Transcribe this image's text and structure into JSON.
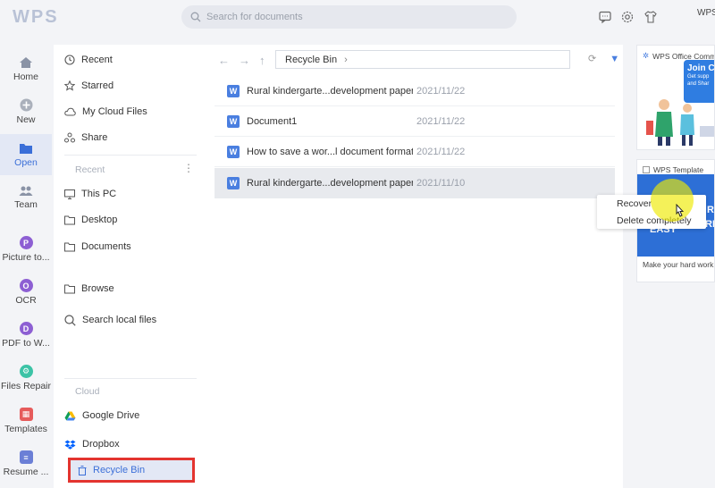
{
  "header": {
    "logo": "WPS",
    "search_placeholder": "Search for documents",
    "user_label": "WPS"
  },
  "rail": [
    {
      "label": "Home",
      "icon": "home-icon"
    },
    {
      "label": "New",
      "icon": "plus-circle-icon"
    },
    {
      "label": "Open",
      "icon": "folder-icon",
      "active": true
    },
    {
      "label": "Team",
      "icon": "team-icon"
    },
    {
      "label": "Picture to...",
      "icon": "picture-to-text-icon",
      "color": "#8d5fd3"
    },
    {
      "label": "OCR",
      "icon": "ocr-icon",
      "color": "#8d5fd3"
    },
    {
      "label": "PDF to W...",
      "icon": "pdf-to-word-icon",
      "color": "#8d5fd3"
    },
    {
      "label": "Files Repair",
      "icon": "files-repair-icon",
      "color": "#3cc3a6"
    },
    {
      "label": "Templates",
      "icon": "templates-icon",
      "color": "#e65b5b"
    },
    {
      "label": "Resume ...",
      "icon": "resume-icon",
      "color": "#6b7fd6"
    }
  ],
  "nav": {
    "items": [
      "Recent",
      "Starred",
      "My Cloud Files",
      "Share"
    ],
    "recent_section": "Recent",
    "locations": [
      "This PC",
      "Desktop",
      "Documents"
    ],
    "browse": "Browse",
    "search_local": "Search local files",
    "cloud_section": "Cloud",
    "cloud_items": [
      "Google Drive",
      "Dropbox"
    ],
    "recycle_bin": "Recycle Bin"
  },
  "main": {
    "path": "Recycle Bin",
    "files": [
      {
        "name": "Rural kindergarte...development paper",
        "date": "2021/11/22"
      },
      {
        "name": "Document1",
        "date": "2021/11/22"
      },
      {
        "name": "How to save a wor...l document format",
        "date": "2021/11/22"
      },
      {
        "name": "Rural kindergarte...development paper",
        "date": "2021/11/10",
        "selected": true
      }
    ]
  },
  "context_menu": {
    "items": [
      "Recover",
      "Delete completely"
    ]
  },
  "right": {
    "card1_title": "WPS Office Comm",
    "card1_banner_title": "Join C",
    "card1_banner_sub": "Get supp and Shar",
    "card2_title": "WPS Template",
    "card2_banner_text": "EASY",
    "card2_banner_side1": "R",
    "card2_banner_side2": "RK",
    "card2_footer": "Make your hard work"
  },
  "colors": {
    "accent": "#3b6fd8",
    "highlight_box": "#e3342f",
    "selected_row": "#e8eaee"
  }
}
